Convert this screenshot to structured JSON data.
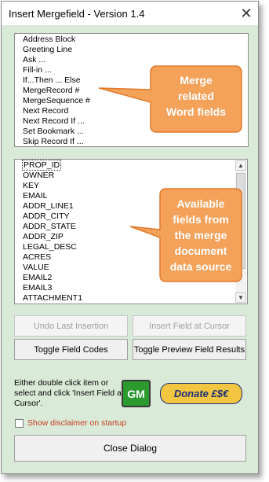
{
  "window": {
    "title": "Insert Mergefield - Version 1.4"
  },
  "word_fields": [
    "Address Block",
    "Greeting Line",
    "Ask ...",
    "Fill-in ...",
    "If...Then ... Else",
    "MergeRecord #",
    "MergeSequence #",
    "Next Record",
    "Next Record If ...",
    "Set Bookmark ...",
    "Skip Record If ..."
  ],
  "data_fields": [
    "PROP_ID",
    "OWNER",
    "KEY",
    "EMAIL",
    "ADDR_LINE1",
    "ADDR_CITY",
    "ADDR_STATE",
    "ADDR_ZIP",
    "LEGAL_DESC",
    "ACRES",
    "VALUE",
    "EMAIL2",
    "EMAIL3",
    "ATTACHMENT1"
  ],
  "callouts": {
    "merge_fields": [
      "Merge",
      "related",
      "Word fields"
    ],
    "data_source": [
      "Available",
      "fields from",
      "the merge",
      "document",
      "data source"
    ]
  },
  "buttons": {
    "undo": "Undo Last Insertion",
    "insert": "Insert Field at Cursor",
    "toggle_codes": "Toggle Field Codes",
    "toggle_preview": "Toggle Preview Field Results",
    "close": "Close Dialog"
  },
  "help_text": "Either double click item or select and click 'Insert Field at Cursor'.",
  "gm_label": "GM",
  "donate_label": "Donate £$€",
  "disclaimer_label": "Show disclaimer on startup",
  "disclaimer_checked": false,
  "colors": {
    "dialog_bg": "#d9ead9",
    "callout_fill": "#f4a15a",
    "callout_border": "#e07a2a",
    "gm_bg": "#2b9a2f",
    "donate_bg": "#f2c640",
    "disclaimer_text": "#c83a1e"
  },
  "icons": {
    "close": "close-icon",
    "scroll_up": "scroll-up-arrow-icon",
    "scroll_down": "scroll-down-arrow-icon"
  }
}
